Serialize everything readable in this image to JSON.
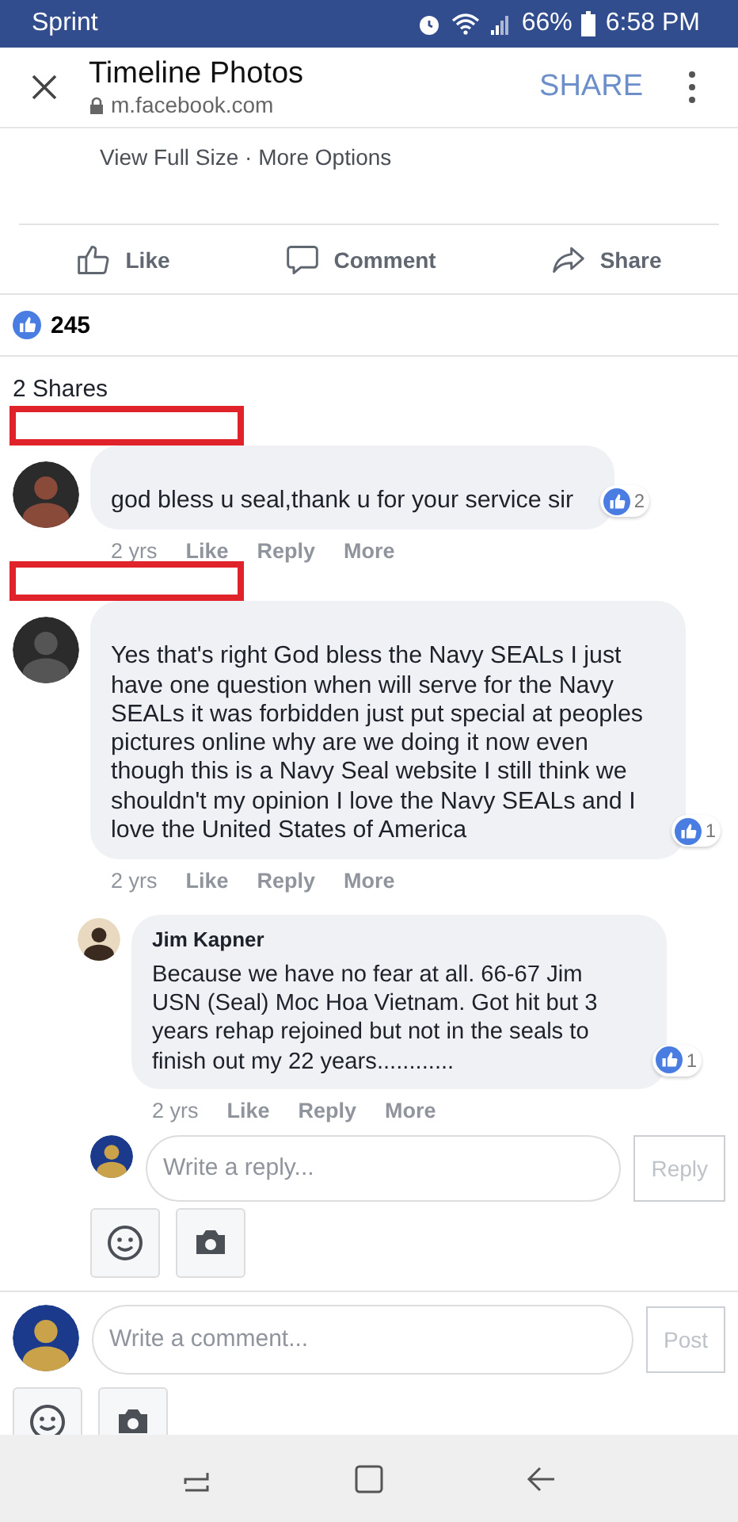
{
  "status_bar": {
    "carrier": "Sprint",
    "battery": "66%",
    "time": "6:58 PM"
  },
  "header": {
    "title": "Timeline Photos",
    "url": "m.facebook.com",
    "share": "SHARE"
  },
  "photo_links": "View Full Size · More Options",
  "actions": [
    {
      "label": "Like",
      "kind": "like"
    },
    {
      "label": "Comment",
      "kind": "comment"
    },
    {
      "label": "Share",
      "kind": "share"
    }
  ],
  "reactions": {
    "count": "245"
  },
  "shares": "2 Shares",
  "comments": [
    {
      "redacted": true,
      "text": "god bless u seal,thank u for your service sir",
      "likes": "2",
      "time": "2 yrs",
      "links": [
        "Like",
        "Reply",
        "More"
      ]
    },
    {
      "redacted": true,
      "text": "Yes that's right God bless the Navy SEALs I just have one question when will serve for the Navy SEALs it was forbidden just put special at peoples pictures online why are we doing it now even though this is a Navy Seal website I still think we shouldn't my opinion I love the Navy SEALs and I love the United States of America",
      "likes": "1",
      "time": "2 yrs",
      "links": [
        "Like",
        "Reply",
        "More"
      ],
      "replies": [
        {
          "redacted": false,
          "author": "Jim Kapner",
          "text": "Because we have no fear at all. 66-67 Jim USN (Seal) Moc Hoa Vietnam. Got hit but 3 years rehap rejoined but not in the seals to finish out my 22 years............",
          "likes": "1",
          "time": "2 yrs",
          "links": [
            "Like",
            "Reply",
            "More"
          ]
        }
      ]
    }
  ],
  "reply_box": {
    "placeholder": "Write a reply...",
    "button": "Reply"
  },
  "comment_box": {
    "placeholder": "Write a comment...",
    "button": "Post"
  }
}
